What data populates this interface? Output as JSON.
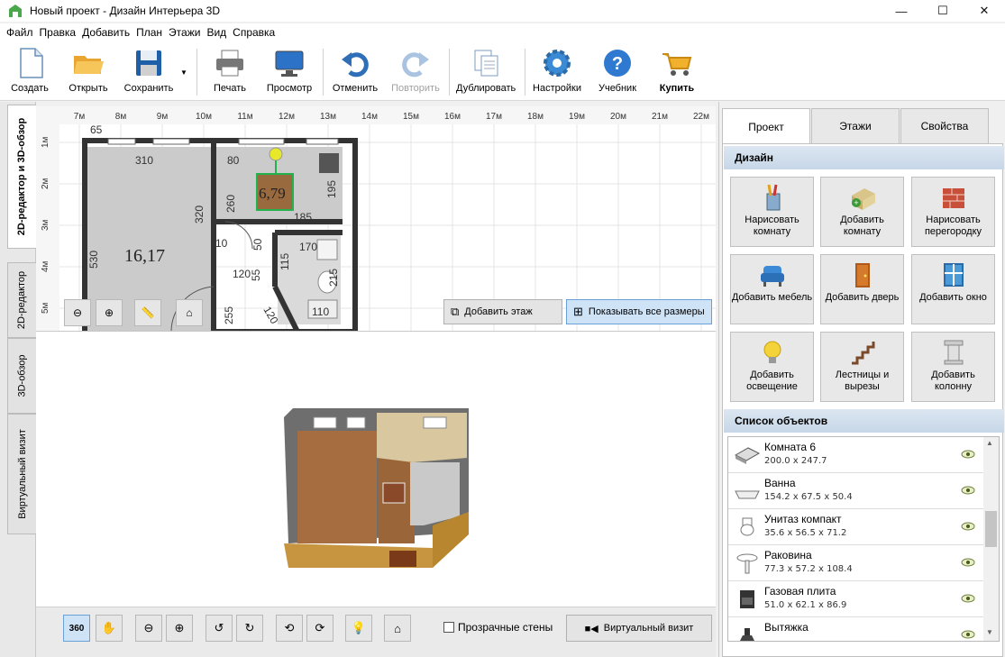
{
  "window": {
    "title": "Новый проект - Дизайн Интерьера 3D",
    "controls": {
      "minimize": "—",
      "maximize": "☐",
      "close": "✕"
    }
  },
  "menu": [
    "Файл",
    "Правка",
    "Добавить",
    "План",
    "Этажи",
    "Вид",
    "Справка"
  ],
  "toolbar": {
    "create": "Создать",
    "open": "Открыть",
    "save": "Сохранить",
    "print": "Печать",
    "preview": "Просмотр",
    "undo": "Отменить",
    "redo": "Повторить",
    "duplicate": "Дублировать",
    "settings": "Настройки",
    "tutorial": "Учебник",
    "buy": "Купить"
  },
  "left_tabs": [
    "2D-редактор и 3D-обзор",
    "2D-редактор",
    "3D-обзор",
    "Виртуальный визит"
  ],
  "plan": {
    "ruler_top": [
      "7м",
      "8м",
      "9м",
      "10м",
      "11м",
      "12м",
      "13м",
      "14м",
      "15м",
      "16м",
      "17м",
      "18м",
      "19м",
      "20м",
      "21м",
      "22м"
    ],
    "ruler_left": [
      "1м",
      "2м",
      "3м",
      "4м",
      "5м"
    ],
    "room_area_main": "16,17",
    "room_area_small": "6,79",
    "dimensions": [
      "310",
      "320",
      "530",
      "80",
      "195",
      "260",
      "185",
      "10",
      "50",
      "170",
      "115",
      "215",
      "120",
      "55",
      "255",
      "120",
      "110",
      "65"
    ],
    "add_floor": "Добавить этаж",
    "show_all_sizes": "Показывать все размеры"
  },
  "bottom": {
    "rotate_360": "360",
    "transparent_walls": "Прозрачные стены",
    "transparent_walls_checked": false,
    "virtual_visit": "Виртуальный визит"
  },
  "right_panel": {
    "tabs": [
      "Проект",
      "Этажи",
      "Свойства"
    ],
    "active_tab": "Проект",
    "design_title": "Дизайн",
    "design_buttons": [
      {
        "label": "Нарисовать комнату",
        "icon": "pencils-icon"
      },
      {
        "label": "Добавить комнату",
        "icon": "add-room-icon"
      },
      {
        "label": "Нарисовать перегородку",
        "icon": "brick-wall-icon"
      },
      {
        "label": "Добавить мебель",
        "icon": "armchair-icon"
      },
      {
        "label": "Добавить дверь",
        "icon": "door-icon"
      },
      {
        "label": "Добавить окно",
        "icon": "window-icon"
      },
      {
        "label": "Добавить освещение",
        "icon": "lightbulb-icon"
      },
      {
        "label": "Лестницы и вырезы",
        "icon": "stairs-icon"
      },
      {
        "label": "Добавить колонну",
        "icon": "column-icon"
      }
    ],
    "objects_title": "Список объектов",
    "objects": [
      {
        "name": "Комната 6",
        "dims": "200.0 x 247.7",
        "icon": "room-icon"
      },
      {
        "name": "Ванна",
        "dims": "154.2 x 67.5 x 50.4",
        "icon": "bathtub-icon"
      },
      {
        "name": "Унитаз компакт",
        "dims": "35.6 x 56.5 x 71.2",
        "icon": "toilet-icon"
      },
      {
        "name": "Раковина",
        "dims": "77.3 x 57.2 x 108.4",
        "icon": "sink-icon"
      },
      {
        "name": "Газовая плита",
        "dims": "51.0 x 62.1 x 86.9",
        "icon": "stove-icon"
      },
      {
        "name": "Вытяжка",
        "dims": "",
        "icon": "hood-icon"
      }
    ]
  },
  "colors": {
    "accent_blue": "#2f7ad0",
    "wall_dark": "#3c3c3c",
    "floor_wood": "#a0673c",
    "room_gray": "#c8c8c8"
  }
}
